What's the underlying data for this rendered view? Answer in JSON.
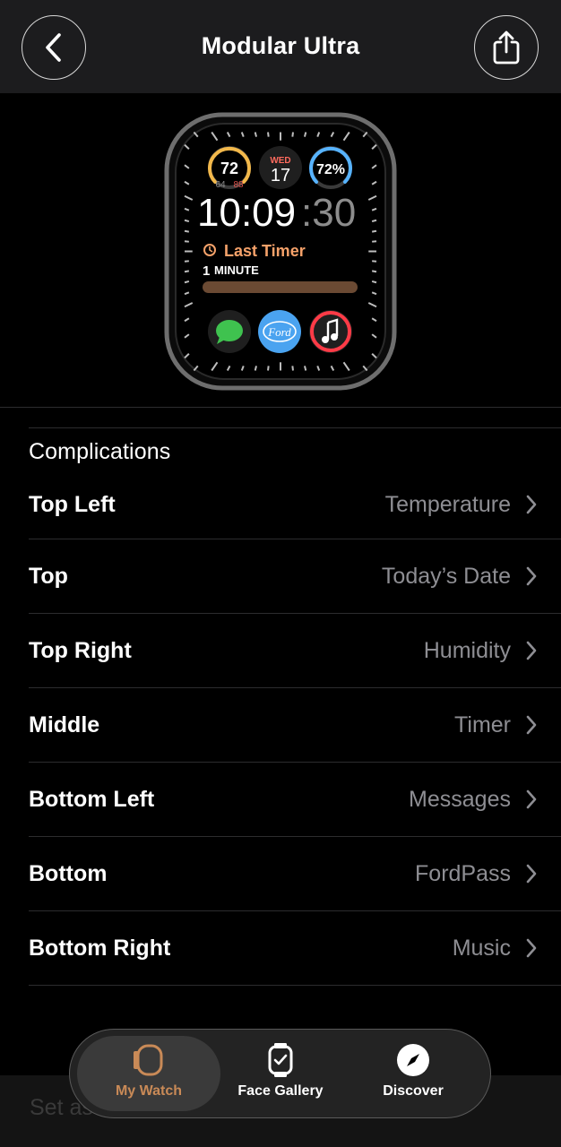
{
  "header": {
    "title": "Modular Ultra",
    "back_icon": "chevron-left-icon",
    "share_icon": "share-icon"
  },
  "watch_face": {
    "top_left_temp": "72",
    "top_left_low": "64",
    "top_left_high": "88",
    "top_day": "WED",
    "top_date": "17",
    "top_right_humidity": "72%",
    "time": "10:09",
    "seconds": ":30",
    "timer_title": "Last Timer",
    "timer_subtitle_num": "1",
    "timer_subtitle_unit": "MINUTE",
    "bottom_center_logo": "Ford",
    "colors": {
      "timer_accent": "#f6a26a",
      "timer_bar": "#6b4a33",
      "messages_green": "#3fc24f",
      "ford_blue": "#4aa3f0",
      "music_red": "#ff3b47"
    }
  },
  "complications": {
    "section_label": "Complications",
    "rows": [
      {
        "label": "Top Left",
        "value": "Temperature"
      },
      {
        "label": "Top",
        "value": "Today’s Date"
      },
      {
        "label": "Top Right",
        "value": "Humidity"
      },
      {
        "label": "Middle",
        "value": "Timer"
      },
      {
        "label": "Bottom Left",
        "value": "Messages"
      },
      {
        "label": "Bottom",
        "value": "FordPass"
      },
      {
        "label": "Bottom Right",
        "value": "Music"
      }
    ]
  },
  "bottom_partial_text": "Set as",
  "tabbar": {
    "tabs": [
      {
        "label": "My Watch",
        "icon": "watch-icon",
        "active": true
      },
      {
        "label": "Face Gallery",
        "icon": "face-gallery-icon",
        "active": false
      },
      {
        "label": "Discover",
        "icon": "compass-icon",
        "active": false
      }
    ],
    "active_color": "#c98a57"
  }
}
